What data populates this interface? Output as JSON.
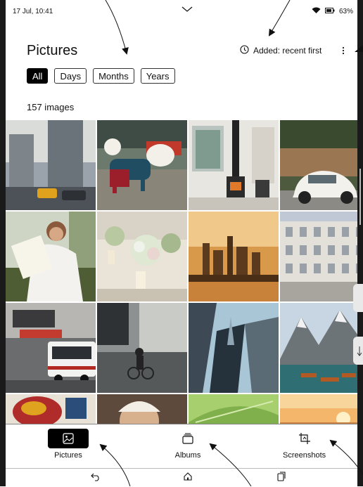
{
  "status": {
    "time": "17 Jul, 10:41",
    "battery": "63%"
  },
  "header": {
    "title": "Pictures",
    "sort_label": "Added: recent first"
  },
  "filters": [
    {
      "label": "All",
      "active": true
    },
    {
      "label": "Days",
      "active": false
    },
    {
      "label": "Months",
      "active": false
    },
    {
      "label": "Years",
      "active": false
    }
  ],
  "count_label": "157 images",
  "grid": {
    "images": [
      "city-street-icon",
      "dog-icon",
      "fireplace-room-icon",
      "vintage-car-icon",
      "woman-reading-icon",
      "flower-table-icon",
      "skyline-sunset-icon",
      "building-facade-icon",
      "tokyo-street-icon",
      "rain-cyclist-icon",
      "skyscraper-icon",
      "mountain-lake-icon",
      "costume-icon",
      "child-portrait-icon",
      "leaf-icon",
      "sunset-icon"
    ]
  },
  "nav": {
    "items": [
      {
        "label": "Pictures",
        "icon": "image-icon",
        "active": true
      },
      {
        "label": "Albums",
        "icon": "albums-icon",
        "active": false
      },
      {
        "label": "Screenshots",
        "icon": "screenshot-icon",
        "active": false
      }
    ]
  },
  "system": {
    "icons": [
      "back-icon",
      "home-icon",
      "recents-icon"
    ]
  }
}
